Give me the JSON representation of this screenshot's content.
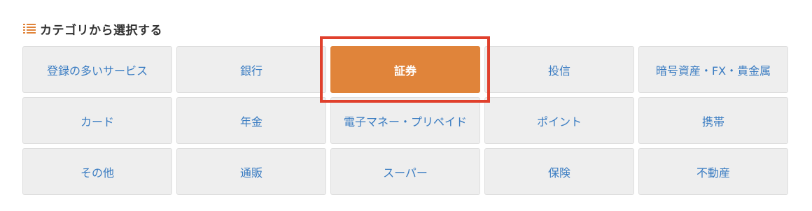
{
  "section": {
    "title": "カテゴリから選択する",
    "icon": "list-icon"
  },
  "categories": [
    {
      "label": "登録の多いサービス",
      "selected": false
    },
    {
      "label": "銀行",
      "selected": false
    },
    {
      "label": "証券",
      "selected": true
    },
    {
      "label": "投信",
      "selected": false
    },
    {
      "label": "暗号資産・FX・貴金属",
      "selected": false
    },
    {
      "label": "カード",
      "selected": false
    },
    {
      "label": "年金",
      "selected": false
    },
    {
      "label": "電子マネー・プリペイド",
      "selected": false
    },
    {
      "label": "ポイント",
      "selected": false
    },
    {
      "label": "携帯",
      "selected": false
    },
    {
      "label": "その他",
      "selected": false
    },
    {
      "label": "通販",
      "selected": false
    },
    {
      "label": "スーパー",
      "selected": false
    },
    {
      "label": "保険",
      "selected": false
    },
    {
      "label": "不動産",
      "selected": false
    }
  ],
  "colors": {
    "accent": "#e0843a",
    "link": "#3a7cc2",
    "tile_bg": "#eeeeee",
    "highlight_border": "#e0402c"
  }
}
